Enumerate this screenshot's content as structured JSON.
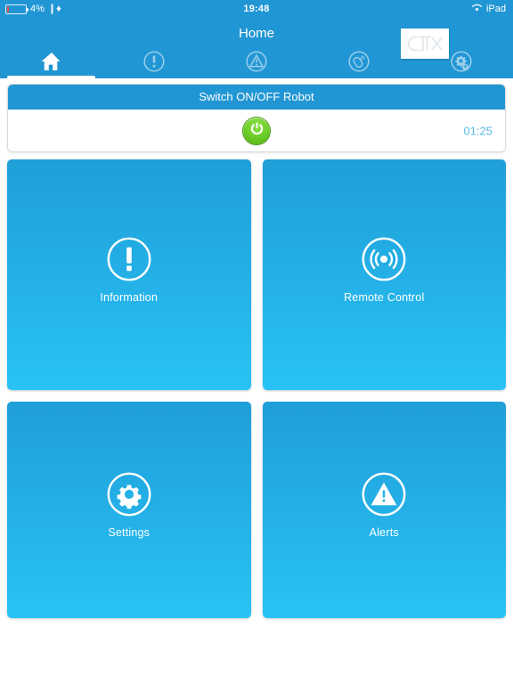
{
  "statusbar": {
    "battery_percent": "4%",
    "bluetooth_icon": "bluetooth-icon",
    "battery_icon": "battery-low-icon",
    "time": "19:48",
    "wifi_icon": "wifi-icon",
    "device_name": "iPad"
  },
  "navbar": {
    "title": "Home",
    "logo_text": "CTX",
    "logo_icon": "ctx-logo-icon"
  },
  "tabbar": {
    "tabs": [
      {
        "name": "tab-home",
        "icon": "home-icon",
        "label": "Home",
        "active": true
      },
      {
        "name": "tab-information",
        "icon": "info-exclamation-icon",
        "label": "Information",
        "active": false
      },
      {
        "name": "tab-alerts",
        "icon": "warning-triangle-icon",
        "label": "Alerts",
        "active": false
      },
      {
        "name": "tab-remote-control",
        "icon": "remote-signal-icon",
        "label": "Remote Control",
        "active": false
      },
      {
        "name": "tab-settings",
        "icon": "gears-icon",
        "label": "Settings",
        "active": false
      }
    ]
  },
  "switch_panel": {
    "header": "Switch ON/OFF Robot",
    "power_button_icon": "power-icon",
    "power_button_state": "on",
    "power_button_color": "#6fcf2a",
    "timer": "01:25",
    "timer_color": "#5bb8e8"
  },
  "tiles": [
    {
      "label": "Information",
      "icon": "info-exclamation-icon",
      "name": "tile-information"
    },
    {
      "label": "Remote Control",
      "icon": "remote-signal-icon",
      "name": "tile-remote-control"
    },
    {
      "label": "Settings",
      "icon": "gear-icon",
      "name": "tile-settings"
    },
    {
      "label": "Alerts",
      "icon": "warning-triangle-icon",
      "name": "tile-alerts"
    }
  ],
  "theme": {
    "brand_blue": "#2196d4",
    "tile_gradient_top": "#1f9fd8",
    "tile_gradient_bottom": "#2ac3f5",
    "background": "#ffffff"
  }
}
